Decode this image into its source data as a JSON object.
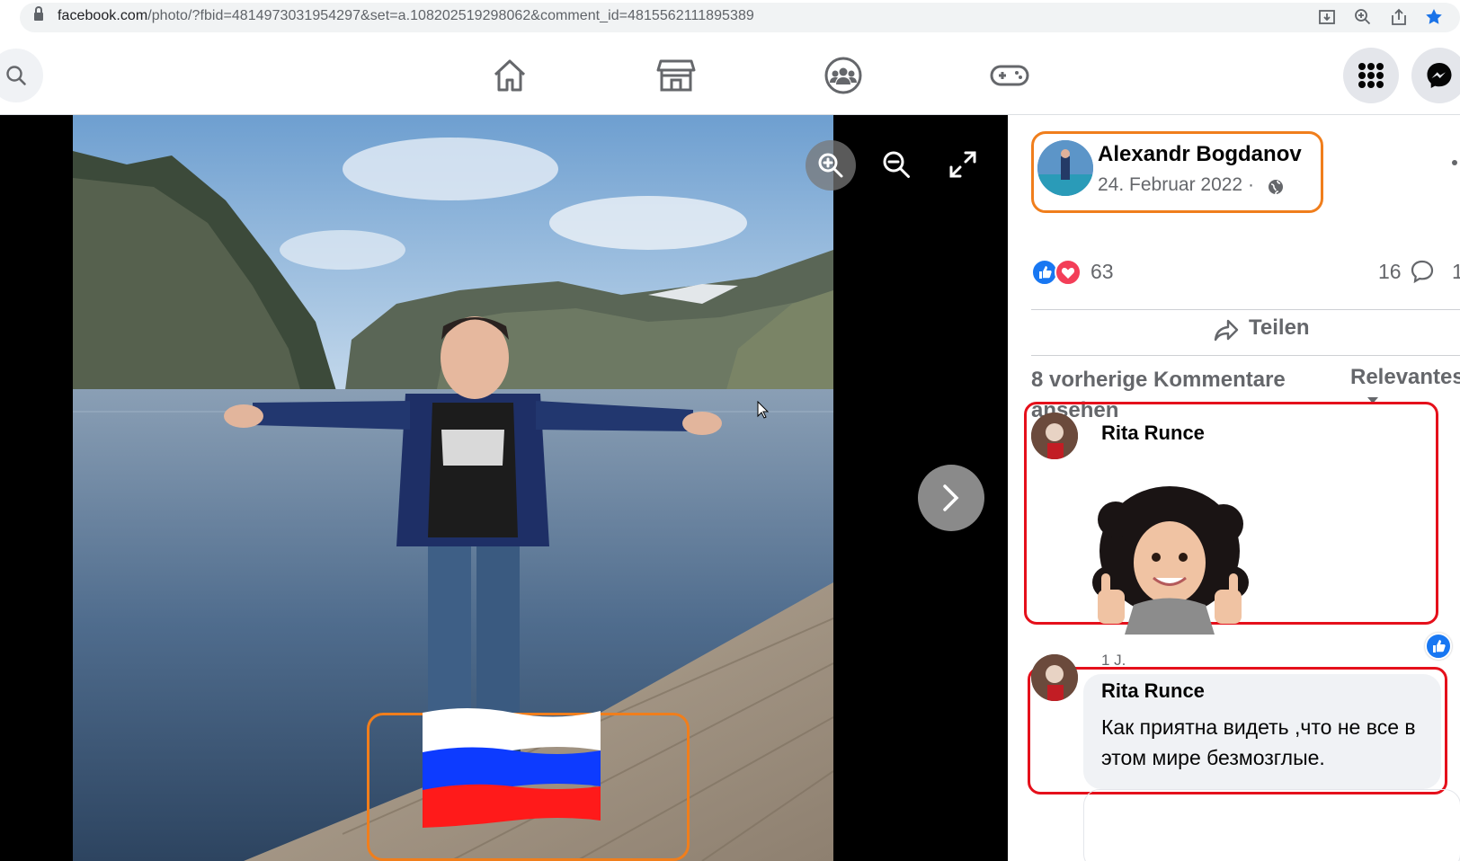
{
  "browser": {
    "url_host": "facebook.com",
    "url_rest": "/photo/?fbid=4814973031954297&set=a.108202519298062&comment_id=4815562111895389"
  },
  "header": {
    "nav": [
      "home-icon",
      "marketplace-icon",
      "groups-icon",
      "gaming-icon"
    ],
    "right": [
      "menu-grid-icon",
      "messenger-icon"
    ]
  },
  "photo": {
    "controls": [
      "zoom-in-icon",
      "zoom-out-icon",
      "fullscreen-icon",
      "next-icon"
    ],
    "flag_colors": [
      "#ffffff",
      "#0d3bff",
      "#ff1a1a"
    ]
  },
  "post": {
    "author": "Alexandr Bogdanov",
    "date": "24. Februar 2022 ·",
    "reaction_count": "63",
    "comment_count": "16",
    "share_count": "1",
    "share_label": "Teilen",
    "previous_comments": "8 vorherige Kommentare ansehen",
    "sort_label": "Relevantes"
  },
  "comments": [
    {
      "author": "Rita Runce",
      "time": "1 J.",
      "sticker": "avatar-thumbs-up-sticker"
    },
    {
      "author": "Rita Runce",
      "text": "Как приятна видеть ,что не все в этом мире безмозглые."
    }
  ],
  "colors": {
    "orange_highlight": "#f07e1c",
    "red_highlight": "#e5101b",
    "facebook_blue": "#1877f2"
  }
}
